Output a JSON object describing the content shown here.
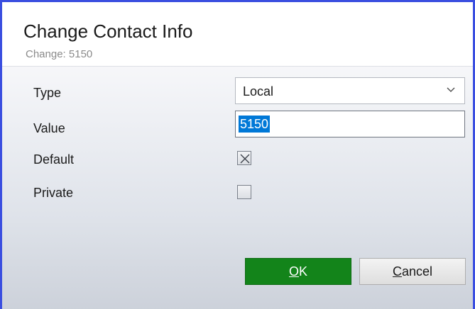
{
  "dialog": {
    "title": "Change Contact Info",
    "subtitle": "Change: 5150"
  },
  "form": {
    "type_label": "Type",
    "type_value": "Local",
    "value_label": "Value",
    "value_text": "5150",
    "default_label": "Default",
    "default_checked": true,
    "private_label": "Private",
    "private_checked": false
  },
  "buttons": {
    "ok_mnemonic": "O",
    "ok_rest": "K",
    "cancel_mnemonic": "C",
    "cancel_rest": "ancel"
  },
  "colors": {
    "border": "#3a4ee0",
    "ok_background": "#13841a",
    "selection": "#0078d7"
  },
  "icons": {
    "dropdown": "chevron-down-icon",
    "checked": "x-check-icon"
  }
}
